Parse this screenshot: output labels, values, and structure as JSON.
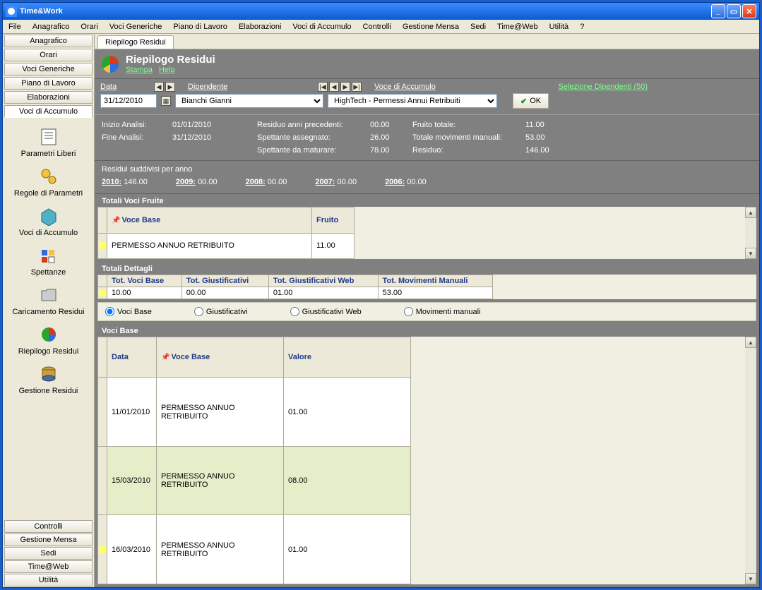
{
  "window_title": "Time&Work",
  "menu": [
    "File",
    "Anagrafico",
    "Orari",
    "Voci Generiche",
    "Piano di Lavoro",
    "Elaborazioni",
    "Voci di Accumulo",
    "Controlli",
    "Gestione Mensa",
    "Sedi",
    "Time@Web",
    "Utilità",
    "?"
  ],
  "sidebar_top": [
    "Anagrafico",
    "Orari",
    "Voci Generiche",
    "Piano di Lavoro",
    "Elaborazioni",
    "Voci di Accumulo"
  ],
  "sidebar_icons": [
    {
      "name": "parametri-liberi",
      "label": "Parametri Liberi"
    },
    {
      "name": "regole-di-parametri",
      "label": "Regole di Parametri"
    },
    {
      "name": "voci-di-accumulo",
      "label": "Voci di Accumulo"
    },
    {
      "name": "spettanze",
      "label": "Spettanze"
    },
    {
      "name": "caricamento-residui",
      "label": "Caricamento Residui"
    },
    {
      "name": "riepilogo-residui",
      "label": "Riepilogo Residui"
    },
    {
      "name": "gestione-residui",
      "label": "Gestione Residui"
    }
  ],
  "sidebar_bottom": [
    "Controlli",
    "Gestione Mensa",
    "Sedi",
    "Time@Web",
    "Utilità"
  ],
  "tab_label": "Riepilogo Residui",
  "page_title": "Riepilogo Residui",
  "page_links": {
    "stampa": "Stampa",
    "help": "Help"
  },
  "filters": {
    "data_label": "Data",
    "data_value": "31/12/2010",
    "dipendente_label": "Dipendente",
    "dipendente_value": "Bianchi Gianni",
    "voce_label": "Voce di Accumulo",
    "voce_value": "HighTech - Permessi Annui Retribuiti",
    "selezione_link": "Selezione Dipendenti (50)",
    "ok_label": "OK"
  },
  "summary": {
    "inizio_label": "Inizio Analisi:",
    "inizio_value": "01/01/2010",
    "fine_label": "Fine Analisi:",
    "fine_value": "31/12/2010",
    "residuo_prec_label": "Residuo anni precedenti:",
    "residuo_prec_value": "00.00",
    "spett_ass_label": "Spettante assegnato:",
    "spett_ass_value": "26.00",
    "spett_mat_label": "Spettante da maturare:",
    "spett_mat_value": "78.00",
    "fruito_label": "Fruito totale:",
    "fruito_value": "11.00",
    "mov_label": "Totale movimenti manuali:",
    "mov_value": "53.00",
    "residuo_label": "Residuo:",
    "residuo_value": "146.00"
  },
  "years": {
    "header": "Residui suddivisi per anno",
    "rows": [
      {
        "year": "2010:",
        "value": "146.00"
      },
      {
        "year": "2009:",
        "value": "00.00"
      },
      {
        "year": "2008:",
        "value": "00.00"
      },
      {
        "year": "2007:",
        "value": "00.00"
      },
      {
        "year": "2006:",
        "value": "00.00"
      }
    ]
  },
  "tot_fruite": {
    "title": "Totali Voci Fruite",
    "headers": {
      "voce": "Voce Base",
      "fruito": "Fruito"
    },
    "rows": [
      {
        "voce": "PERMESSO ANNUO RETRIBUITO",
        "fruito": "11.00"
      }
    ]
  },
  "tot_dettagli": {
    "title": "Totali Dettagli",
    "headers": {
      "voci": "Tot. Voci Base",
      "giust": "Tot. Giustificativi",
      "giustw": "Tot. Giustificativi Web",
      "mov": "Tot. Movimenti Manuali"
    },
    "row": {
      "voci": "10.00",
      "giust": "00.00",
      "giustw": "01.00",
      "mov": "53.00"
    }
  },
  "radios": {
    "voci": "Voci Base",
    "giust": "Giustificativi",
    "giustw": "Giustificativi Web",
    "mov": "Movimenti manuali"
  },
  "detail": {
    "title": "Voci Base",
    "headers": {
      "data": "Data",
      "voce": "Voce Base",
      "valore": "Valore"
    },
    "rows": [
      {
        "data": "11/01/2010",
        "voce": "PERMESSO ANNUO RETRIBUITO",
        "valore": "01.00"
      },
      {
        "data": "15/03/2010",
        "voce": "PERMESSO ANNUO RETRIBUITO",
        "valore": "08.00"
      },
      {
        "data": "16/03/2010",
        "voce": "PERMESSO ANNUO RETRIBUITO",
        "valore": "01.00"
      }
    ]
  }
}
